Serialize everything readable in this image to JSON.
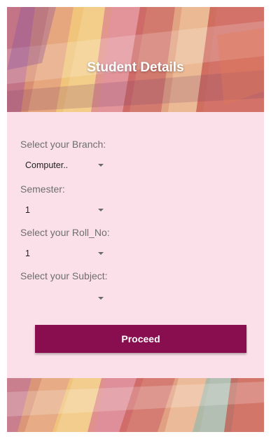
{
  "header": {
    "title": "Student Details"
  },
  "form": {
    "branch": {
      "label": "Select your Branch:",
      "value": "Computer.."
    },
    "semester": {
      "label": "Semester:",
      "value": "1"
    },
    "roll_no": {
      "label": "Select your Roll_No:",
      "value": "1"
    },
    "subject": {
      "label": "Select your Subject:",
      "value": ""
    },
    "proceed_label": "Proceed"
  },
  "colors": {
    "background": "#fbe0ea",
    "button": "#880e4f",
    "button_text": "#ffffff"
  },
  "icons": [
    "dropdown-arrow-icon"
  ]
}
